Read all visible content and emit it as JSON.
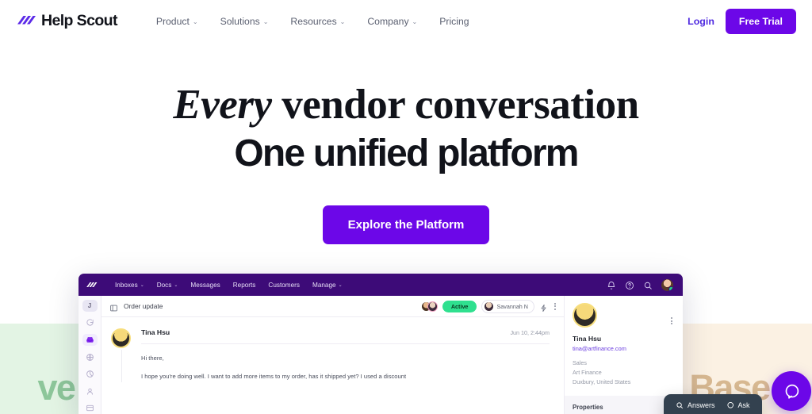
{
  "brand": {
    "name": "Help Scout",
    "logo_icon": "helpscout-slashes-logo",
    "accent_purple": "#6c07e8",
    "app_purple": "#3d0b78",
    "link_purple": "#4f2ae0"
  },
  "site_nav": {
    "items": [
      {
        "label": "Product",
        "has_caret": true,
        "caret": "⌄"
      },
      {
        "label": "Solutions",
        "has_caret": true,
        "caret": "⌄"
      },
      {
        "label": "Resources",
        "has_caret": true,
        "caret": "⌄"
      },
      {
        "label": "Company",
        "has_caret": true,
        "caret": "⌄"
      },
      {
        "label": "Pricing",
        "has_caret": false,
        "caret": ""
      }
    ],
    "login_label": "Login",
    "trial_label": "Free Trial"
  },
  "hero": {
    "line1_italic": "Every",
    "line1_rest": " vendor conversation",
    "line2": "One unified platform",
    "cta_label": "Explore the Platform"
  },
  "background_cards": {
    "left_word": "ve Ch",
    "left_color": "#8dc69a",
    "right_word": "e Base",
    "right_color": "#d7b891"
  },
  "app": {
    "topnav": {
      "logo_icon": "helpscout-slashes-logo",
      "items": [
        {
          "label": "Inboxes",
          "has_caret": true,
          "caret": "⌄"
        },
        {
          "label": "Docs",
          "has_caret": true,
          "caret": "⌄"
        },
        {
          "label": "Messages",
          "has_caret": false,
          "caret": ""
        },
        {
          "label": "Reports",
          "has_caret": false,
          "caret": ""
        },
        {
          "label": "Customers",
          "has_caret": false,
          "caret": ""
        },
        {
          "label": "Manage",
          "has_caret": true,
          "caret": "⌄"
        }
      ],
      "icons": [
        "bell-icon",
        "help-circle-icon",
        "search-icon"
      ],
      "avatar": "user-avatar"
    },
    "rail": {
      "badge_label": "J",
      "icons": [
        "chat-bubble-icon",
        "inbox-icon",
        "globe-icon",
        "pie-chart-icon",
        "person-icon",
        "archive-icon"
      ],
      "active_index": 1
    },
    "conversation": {
      "panel_icon": "side-panel-icon",
      "title": "Order update",
      "status_label": "Active",
      "assignee_label": "Savannah N",
      "tools": [
        "workflow-bolt-icon",
        "more-options-icon"
      ],
      "message": {
        "author": "Tina Hsu",
        "timestamp": "Jun 10, 2:44pm",
        "greeting": "Hi there,",
        "body": "I hope you're doing well. I want to add more items to my order, has it shipped yet? I used a discount"
      }
    },
    "customer": {
      "name": "Tina Hsu",
      "email": "tina@artfinance.com",
      "role": "Sales",
      "company": "Art Finance",
      "location": "Duxbury, United States",
      "properties_title": "Properties",
      "more_icon": "more-options-icon"
    }
  },
  "widgets": {
    "answers_label": "Answers",
    "answers_icon": "search-icon",
    "ask_label": "Ask",
    "ask_icon": "chat-bubble-icon",
    "chat_icon": "chat-bubble-icon"
  }
}
